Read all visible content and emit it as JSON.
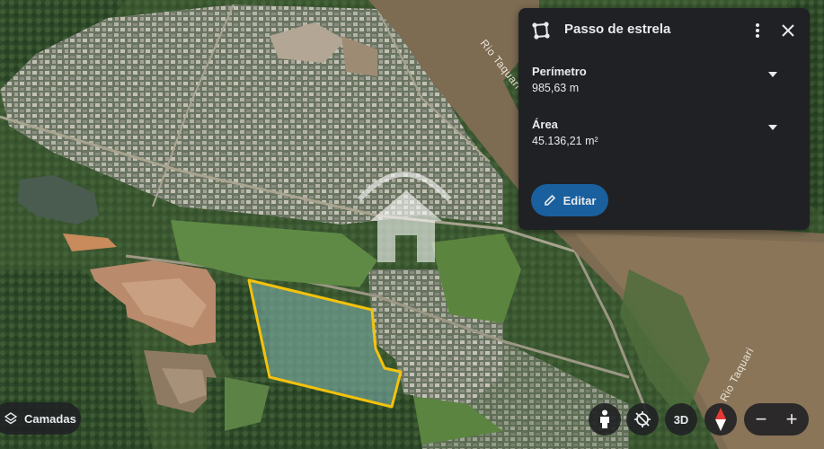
{
  "map": {
    "river_labels": [
      "Rio Taquari",
      "Rio Taquari"
    ],
    "polygon_outline_color": "#f4c20d",
    "overlay_icon": "house-watermark-icon"
  },
  "panel": {
    "icon": "polygon-measure-icon",
    "title": "Passo de estrela",
    "metrics": [
      {
        "label": "Perímetro",
        "value": "985,63 m"
      },
      {
        "label": "Área",
        "value": "45.136,21 m²"
      }
    ],
    "edit_label": "Editar",
    "edit_icon": "pencil-icon"
  },
  "controls": {
    "layers_label": "Camadas",
    "layers_icon": "layers-icon",
    "pegman_icon": "pegman-icon",
    "tilt_icon": "tilt-toggle-icon",
    "btn_3d_label": "3D",
    "compass_icon": "compass-icon",
    "zoom_out": "−",
    "zoom_in": "+"
  },
  "colors": {
    "panel_bg": "#202124",
    "edit_button": "#1a5f9e",
    "text": "#e8eaed"
  }
}
